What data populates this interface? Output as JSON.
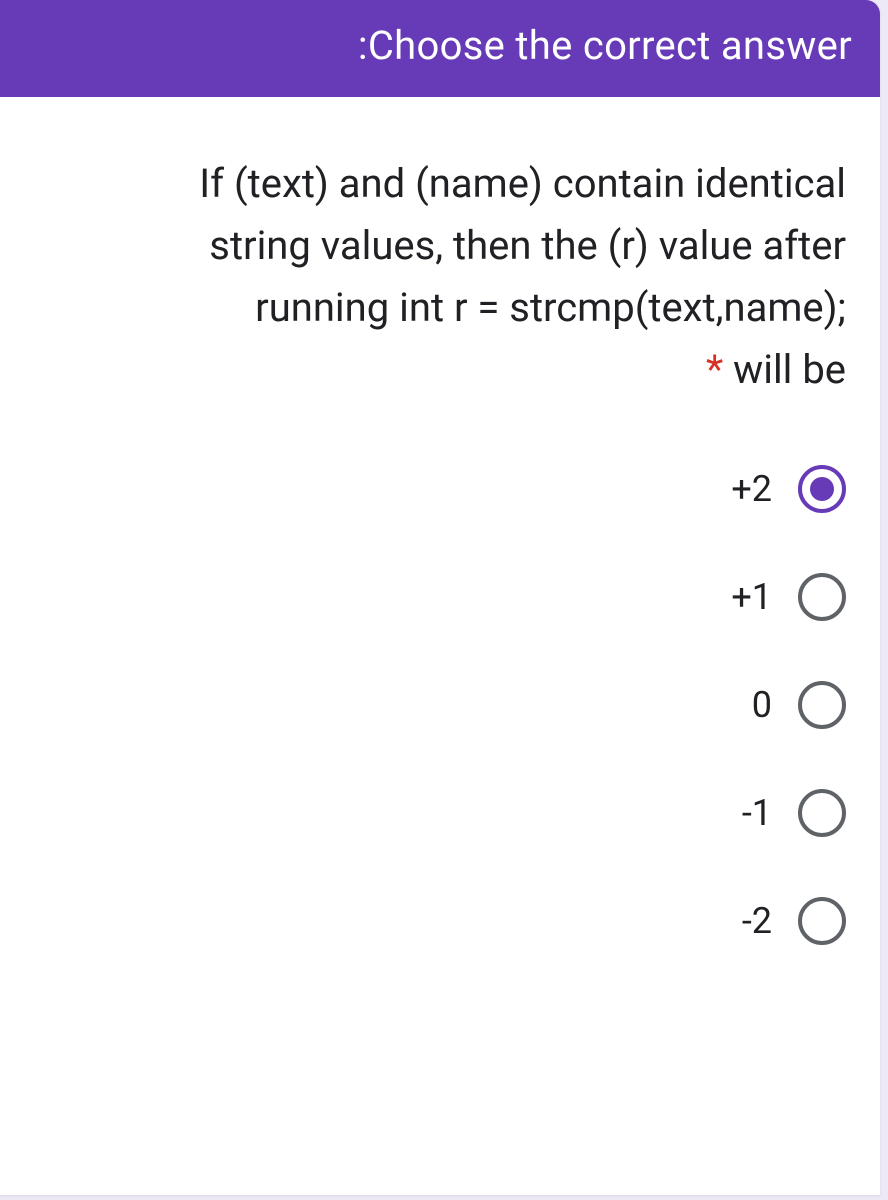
{
  "header": {
    "title": ":Choose the correct answer"
  },
  "question": {
    "line1": "If (text) and (name) contain identical",
    "line2": "string values, then the (r) value after",
    "line3": "running int r = strcmp(text,name);",
    "line4_suffix": " will be",
    "asterisk": "*"
  },
  "options": [
    {
      "label": "+2",
      "selected": true
    },
    {
      "label": "+1",
      "selected": false
    },
    {
      "label": "0",
      "selected": false
    },
    {
      "label": "-1",
      "selected": false
    },
    {
      "label": "-2",
      "selected": false
    }
  ]
}
